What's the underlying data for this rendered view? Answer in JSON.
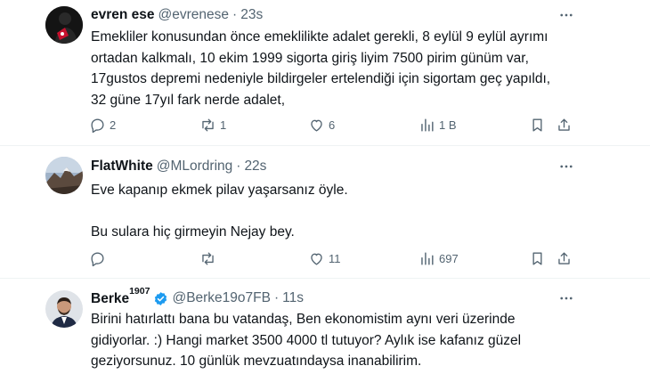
{
  "tweets": [
    {
      "name": "evren ese",
      "handle": "@evrenese",
      "time": "23s",
      "text": "Emekliler konusundan önce emeklilikte adalet gerekli, 8 eylül 9 eylül ayrımı\nortadan kalkmalı, 10 ekim 1999 sigorta giriş liyim 7500 pirim günüm var,\n17gustos depremi nedeniyle bildirgeler ertelendiği için sigortam geç yapıldı,\n32 güne 17yıl fark nerde adalet,",
      "replies": "2",
      "retweets": "1",
      "likes": "6",
      "views": "1 B"
    },
    {
      "name": "FlatWhite",
      "handle": "@MLordring",
      "time": "22s",
      "text": "Eve kapanıp ekmek pilav yaşarsanız öyle.\n\nBu sulara hiç girmeyin Nejay bey.",
      "replies": "",
      "retweets": "",
      "likes": "11",
      "views": "697"
    },
    {
      "name": "Berke",
      "name_sup": "1907",
      "handle": "@Berke19o7FB",
      "time": "11s",
      "text": "Birini hatırlattı bana bu vatandaş, Ben ekonomistim aynı veri üzerinde\ngidiyorlar. :) Hangi market 3500 4000 tl tutuyor? Aylık ise kafanız güzel\ngeziyorsunuz. 10 günlük mevzuatındaysa inanabilirim."
    }
  ],
  "colors": {
    "muted": "#536471",
    "text": "#0f1419",
    "verified": "#1d9bf0",
    "divider": "#eff3f4"
  },
  "icons": [
    "more-icon",
    "reply-icon",
    "retweet-icon",
    "like-icon",
    "views-icon",
    "bookmark-icon",
    "share-icon",
    "verified-icon"
  ]
}
